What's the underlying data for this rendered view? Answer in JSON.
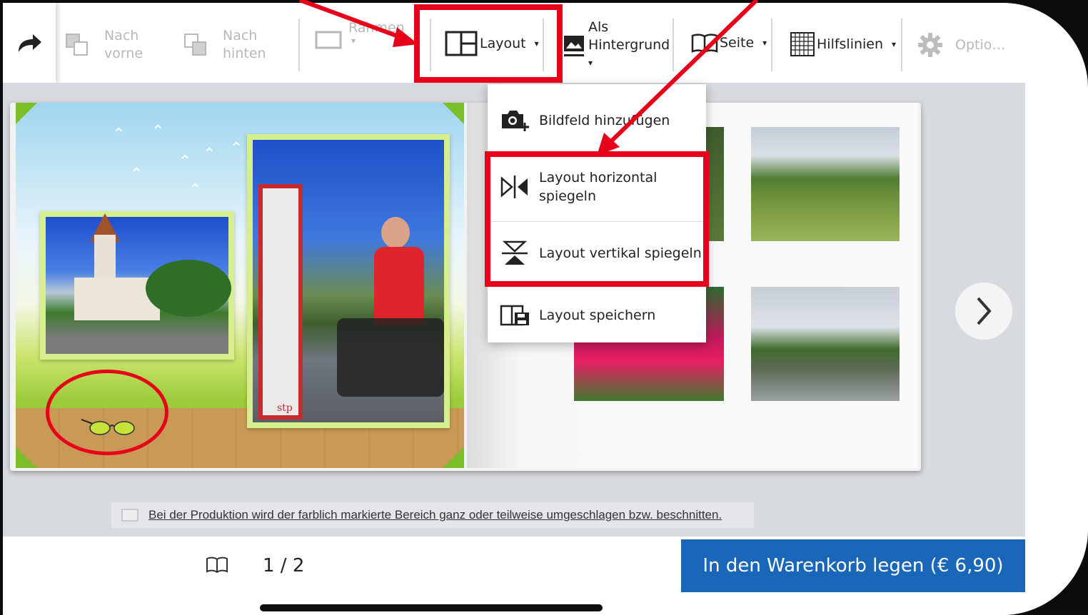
{
  "toolbar": {
    "bring_forward": "Nach\nvorne",
    "bring_forward_l1": "Nach",
    "bring_forward_l2": "vorne",
    "send_back_l1": "Nach",
    "send_back_l2": "hinten",
    "frame": "Rahmen",
    "layout": "Layout",
    "background_l1": "Als",
    "background_l2": "Hintergrund",
    "page": "Seite",
    "guides": "Hilfslinien",
    "options": "Optio…"
  },
  "dropdown": {
    "items": [
      {
        "label": "Bildfeld hinzufügen",
        "icon": "camera-add-icon"
      },
      {
        "label_l1": "Layout horizontal",
        "label_l2": "spiegeln",
        "icon": "mirror-horizontal-icon"
      },
      {
        "label": "Layout vertikal spiegeln",
        "icon": "mirror-vertical-icon"
      },
      {
        "label": "Layout speichern",
        "icon": "layout-save-icon"
      }
    ]
  },
  "notice": {
    "text": "Bei der Produktion wird der farblich markierte Bereich ganz oder teilweise umgeschlagen bzw. beschnitten."
  },
  "pager": {
    "text": "1 / 2"
  },
  "cart": {
    "label": "In den Warenkorb legen (€ 6,90)"
  },
  "photos": {
    "stele_brand": "stp"
  },
  "colors": {
    "highlight": "#e8001b",
    "cart_button": "#1a66b8",
    "frame_green": "#d6ee8c"
  }
}
